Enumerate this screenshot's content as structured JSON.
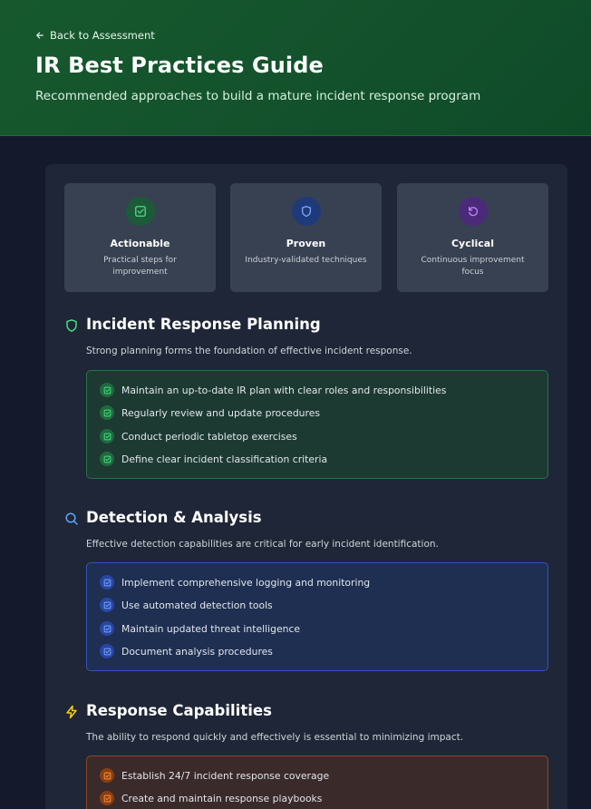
{
  "header": {
    "back_label": "Back to Assessment",
    "title": "IR Best Practices Guide",
    "subtitle": "Recommended approaches to build a mature incident response program"
  },
  "features": [
    {
      "title": "Actionable",
      "description": "Practical steps for improvement",
      "icon": "check-square-icon"
    },
    {
      "title": "Proven",
      "description": "Industry-validated techniques",
      "icon": "shield-icon"
    },
    {
      "title": "Cyclical",
      "description": "Continuous improvement focus",
      "icon": "rotate-icon"
    }
  ],
  "sections": [
    {
      "title": "Incident Response Planning",
      "description": "Strong planning forms the foundation of effective incident response.",
      "icon": "shield-icon",
      "accent": "#22c55e",
      "items": [
        "Maintain an up-to-date IR plan with clear roles and responsibilities",
        "Regularly review and update procedures",
        "Conduct periodic tabletop exercises",
        "Define clear incident classification criteria"
      ]
    },
    {
      "title": "Detection & Analysis",
      "description": "Effective detection capabilities are critical for early incident identification.",
      "icon": "search-icon",
      "accent": "#3b82f6",
      "items": [
        "Implement comprehensive logging and monitoring",
        "Use automated detection tools",
        "Maintain updated threat intelligence",
        "Document analysis procedures"
      ]
    },
    {
      "title": "Response Capabilities",
      "description": "The ability to respond quickly and effectively is essential to minimizing impact.",
      "icon": "lightning-icon",
      "accent": "#f97316",
      "items": [
        "Establish 24/7 incident response coverage",
        "Create and maintain response playbooks"
      ]
    }
  ]
}
